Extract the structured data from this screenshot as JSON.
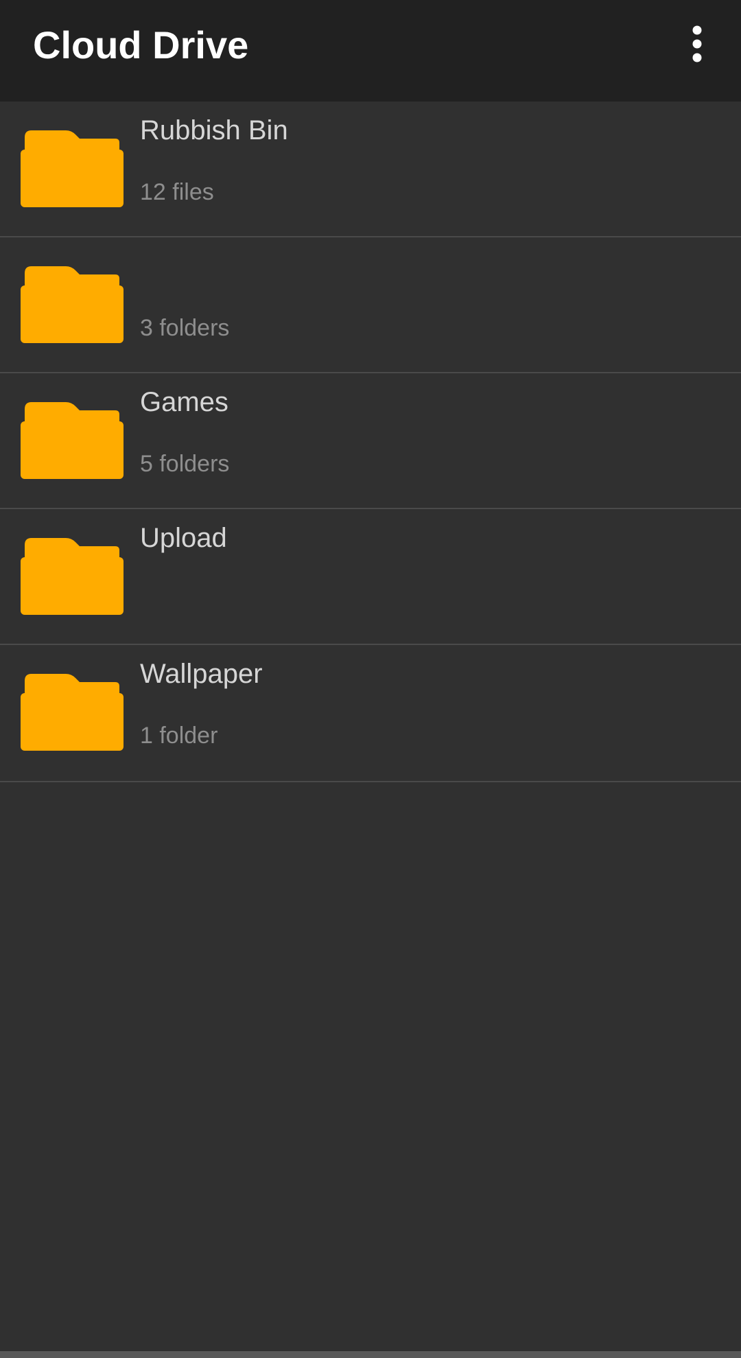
{
  "app_bar": {
    "title": "Cloud Drive",
    "menu_icon": "more-vert-icon"
  },
  "accent_color": "#FFAC00",
  "folders": [
    {
      "name": "Rubbish Bin",
      "meta": "12 files",
      "icon": "folder-icon"
    },
    {
      "name": "",
      "meta": "3 folders",
      "icon": "folder-icon"
    },
    {
      "name": "Games",
      "meta": "5 folders",
      "icon": "folder-icon"
    },
    {
      "name": "Upload",
      "meta": "",
      "icon": "folder-icon"
    },
    {
      "name": "Wallpaper",
      "meta": "1 folder",
      "icon": "folder-icon"
    }
  ]
}
